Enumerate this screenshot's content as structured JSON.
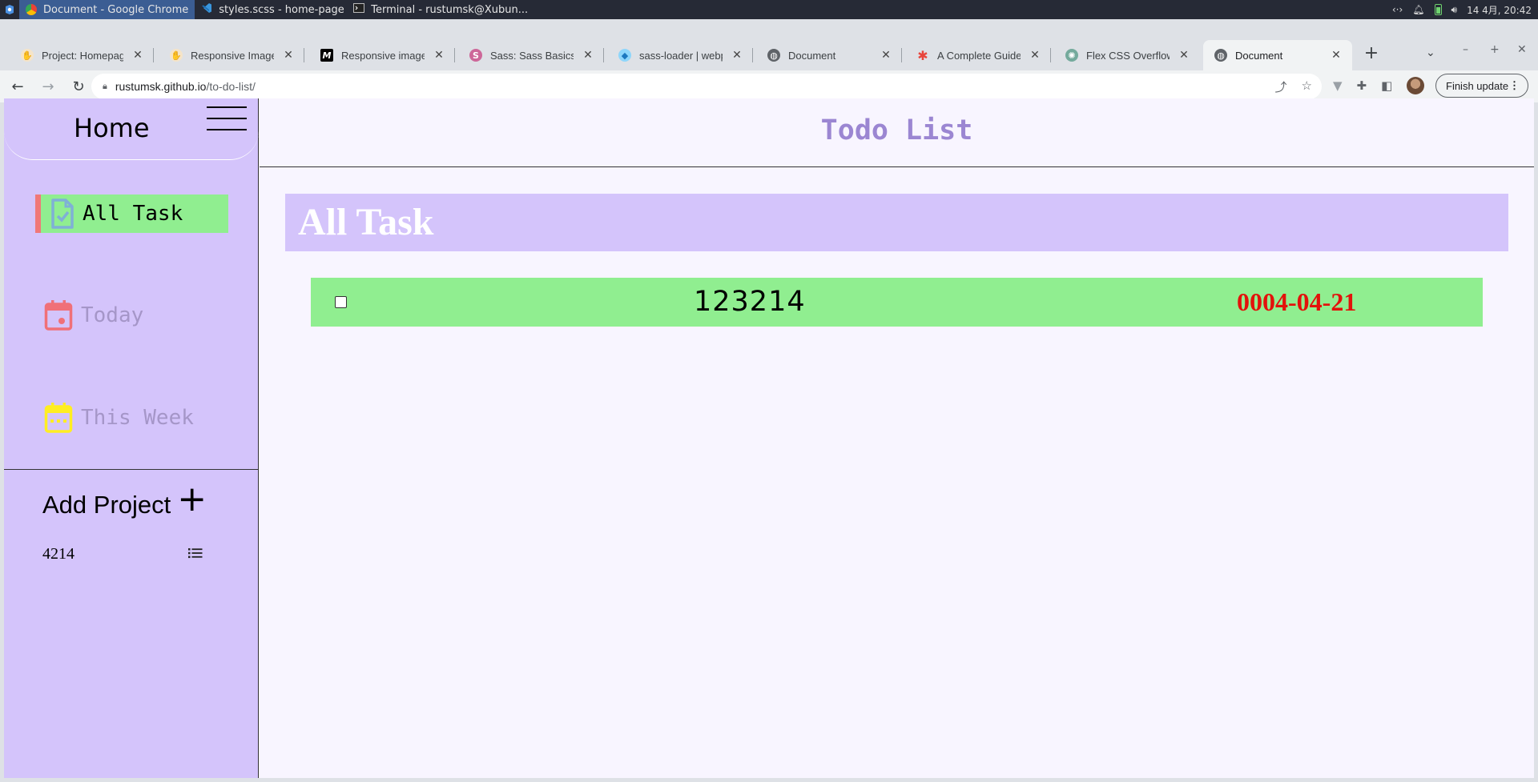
{
  "os": {
    "taskbar": [
      {
        "label": "Document - Google Chrome",
        "icon": "chrome-icon",
        "active": true
      },
      {
        "label": "styles.scss - home-page - Vi...",
        "icon": "vscode-icon",
        "active": false
      },
      {
        "label": "Terminal - rustumsk@Xubun...",
        "icon": "terminal-icon",
        "active": false
      }
    ],
    "clock": "14 4月, 20:42"
  },
  "browser": {
    "tabs": [
      {
        "title": "Project: Homepage |",
        "favicon": "odin-icon"
      },
      {
        "title": "Responsive Images |",
        "favicon": "odin-icon"
      },
      {
        "title": "Responsive images -",
        "favicon": "mdn-icon"
      },
      {
        "title": "Sass: Sass Basics",
        "favicon": "sass-icon"
      },
      {
        "title": "sass-loader | webpa",
        "favicon": "webpack-icon"
      },
      {
        "title": "Document",
        "favicon": "globe-icon"
      },
      {
        "title": "A Complete Guide to",
        "favicon": "css-tricks-icon"
      },
      {
        "title": "Flex CSS Overflow Iss",
        "favicon": "openai-icon"
      },
      {
        "title": "Document",
        "favicon": "globe-icon"
      }
    ],
    "active_tab_index": 8,
    "new_tab_label": "+",
    "address": {
      "host": "rustumsk.github.io",
      "path": "/to-do-list/"
    },
    "finish_update_label": "Finish update"
  },
  "app": {
    "sidebar": {
      "home_label": "Home",
      "nav": [
        {
          "label": "All Task",
          "icon": "file-check-icon",
          "color": "#7fb0d6",
          "active": true
        },
        {
          "label": "Today",
          "icon": "calendar-day-icon",
          "color": "#f07078",
          "active": false
        },
        {
          "label": "This Week",
          "icon": "calendar-week-icon",
          "color": "#ffee22",
          "active": false
        }
      ],
      "add_project_label": "Add Project",
      "add_project_icon": "+",
      "projects": [
        {
          "name": "4214",
          "icon": "list-icon"
        }
      ]
    },
    "header_title": "Todo List",
    "section_title": "All Task",
    "tasks": [
      {
        "name": "123214",
        "date": "0004-04-21",
        "done": false
      }
    ],
    "colors": {
      "sidebar_bg": "#d4c4fb",
      "task_bg": "#90ee90",
      "date_color": "#e3120b",
      "title_color": "#9b86d2",
      "active_marker": "#f07878"
    }
  }
}
